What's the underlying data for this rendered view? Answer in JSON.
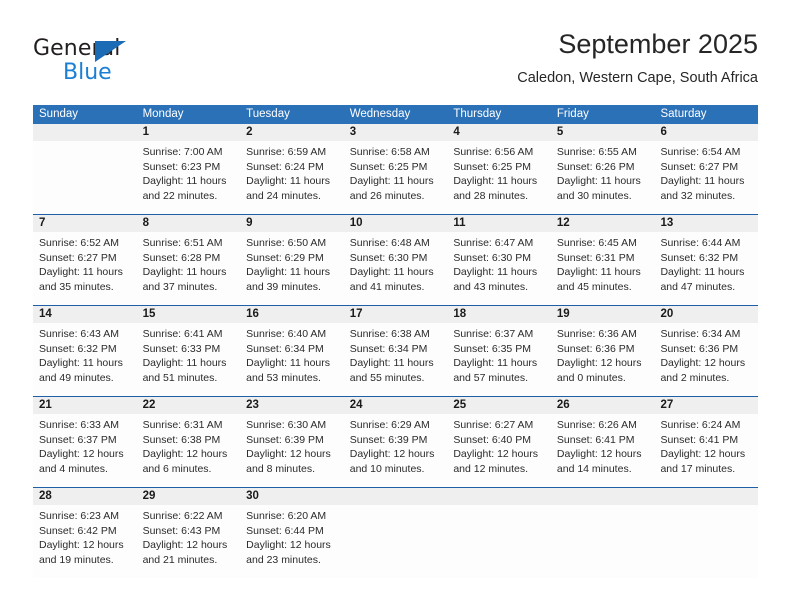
{
  "logo": {
    "word1": "General",
    "word2": "Blue",
    "triangle_color": "#1c6cb5",
    "blue_text_color": "#1b7fd4"
  },
  "header": {
    "title": "September 2025",
    "subtitle": "Caledon, Western Cape, South Africa"
  },
  "colors": {
    "header_row_bg": "#2b71b8",
    "week_separator": "#1f5fa8",
    "date_band_bg": "#efefef",
    "cell_bg": "#fdfdfd",
    "text": "#2b2b2b"
  },
  "weekday_headers": [
    "Sunday",
    "Monday",
    "Tuesday",
    "Wednesday",
    "Thursday",
    "Friday",
    "Saturday"
  ],
  "weeks": [
    [
      {
        "day": "",
        "sunrise": "",
        "sunset": "",
        "daylight_line1": "",
        "daylight_line2": ""
      },
      {
        "day": "1",
        "sunrise": "Sunrise: 7:00 AM",
        "sunset": "Sunset: 6:23 PM",
        "daylight_line1": "Daylight: 11 hours",
        "daylight_line2": "and 22 minutes."
      },
      {
        "day": "2",
        "sunrise": "Sunrise: 6:59 AM",
        "sunset": "Sunset: 6:24 PM",
        "daylight_line1": "Daylight: 11 hours",
        "daylight_line2": "and 24 minutes."
      },
      {
        "day": "3",
        "sunrise": "Sunrise: 6:58 AM",
        "sunset": "Sunset: 6:25 PM",
        "daylight_line1": "Daylight: 11 hours",
        "daylight_line2": "and 26 minutes."
      },
      {
        "day": "4",
        "sunrise": "Sunrise: 6:56 AM",
        "sunset": "Sunset: 6:25 PM",
        "daylight_line1": "Daylight: 11 hours",
        "daylight_line2": "and 28 minutes."
      },
      {
        "day": "5",
        "sunrise": "Sunrise: 6:55 AM",
        "sunset": "Sunset: 6:26 PM",
        "daylight_line1": "Daylight: 11 hours",
        "daylight_line2": "and 30 minutes."
      },
      {
        "day": "6",
        "sunrise": "Sunrise: 6:54 AM",
        "sunset": "Sunset: 6:27 PM",
        "daylight_line1": "Daylight: 11 hours",
        "daylight_line2": "and 32 minutes."
      }
    ],
    [
      {
        "day": "7",
        "sunrise": "Sunrise: 6:52 AM",
        "sunset": "Sunset: 6:27 PM",
        "daylight_line1": "Daylight: 11 hours",
        "daylight_line2": "and 35 minutes."
      },
      {
        "day": "8",
        "sunrise": "Sunrise: 6:51 AM",
        "sunset": "Sunset: 6:28 PM",
        "daylight_line1": "Daylight: 11 hours",
        "daylight_line2": "and 37 minutes."
      },
      {
        "day": "9",
        "sunrise": "Sunrise: 6:50 AM",
        "sunset": "Sunset: 6:29 PM",
        "daylight_line1": "Daylight: 11 hours",
        "daylight_line2": "and 39 minutes."
      },
      {
        "day": "10",
        "sunrise": "Sunrise: 6:48 AM",
        "sunset": "Sunset: 6:30 PM",
        "daylight_line1": "Daylight: 11 hours",
        "daylight_line2": "and 41 minutes."
      },
      {
        "day": "11",
        "sunrise": "Sunrise: 6:47 AM",
        "sunset": "Sunset: 6:30 PM",
        "daylight_line1": "Daylight: 11 hours",
        "daylight_line2": "and 43 minutes."
      },
      {
        "day": "12",
        "sunrise": "Sunrise: 6:45 AM",
        "sunset": "Sunset: 6:31 PM",
        "daylight_line1": "Daylight: 11 hours",
        "daylight_line2": "and 45 minutes."
      },
      {
        "day": "13",
        "sunrise": "Sunrise: 6:44 AM",
        "sunset": "Sunset: 6:32 PM",
        "daylight_line1": "Daylight: 11 hours",
        "daylight_line2": "and 47 minutes."
      }
    ],
    [
      {
        "day": "14",
        "sunrise": "Sunrise: 6:43 AM",
        "sunset": "Sunset: 6:32 PM",
        "daylight_line1": "Daylight: 11 hours",
        "daylight_line2": "and 49 minutes."
      },
      {
        "day": "15",
        "sunrise": "Sunrise: 6:41 AM",
        "sunset": "Sunset: 6:33 PM",
        "daylight_line1": "Daylight: 11 hours",
        "daylight_line2": "and 51 minutes."
      },
      {
        "day": "16",
        "sunrise": "Sunrise: 6:40 AM",
        "sunset": "Sunset: 6:34 PM",
        "daylight_line1": "Daylight: 11 hours",
        "daylight_line2": "and 53 minutes."
      },
      {
        "day": "17",
        "sunrise": "Sunrise: 6:38 AM",
        "sunset": "Sunset: 6:34 PM",
        "daylight_line1": "Daylight: 11 hours",
        "daylight_line2": "and 55 minutes."
      },
      {
        "day": "18",
        "sunrise": "Sunrise: 6:37 AM",
        "sunset": "Sunset: 6:35 PM",
        "daylight_line1": "Daylight: 11 hours",
        "daylight_line2": "and 57 minutes."
      },
      {
        "day": "19",
        "sunrise": "Sunrise: 6:36 AM",
        "sunset": "Sunset: 6:36 PM",
        "daylight_line1": "Daylight: 12 hours",
        "daylight_line2": "and 0 minutes."
      },
      {
        "day": "20",
        "sunrise": "Sunrise: 6:34 AM",
        "sunset": "Sunset: 6:36 PM",
        "daylight_line1": "Daylight: 12 hours",
        "daylight_line2": "and 2 minutes."
      }
    ],
    [
      {
        "day": "21",
        "sunrise": "Sunrise: 6:33 AM",
        "sunset": "Sunset: 6:37 PM",
        "daylight_line1": "Daylight: 12 hours",
        "daylight_line2": "and 4 minutes."
      },
      {
        "day": "22",
        "sunrise": "Sunrise: 6:31 AM",
        "sunset": "Sunset: 6:38 PM",
        "daylight_line1": "Daylight: 12 hours",
        "daylight_line2": "and 6 minutes."
      },
      {
        "day": "23",
        "sunrise": "Sunrise: 6:30 AM",
        "sunset": "Sunset: 6:39 PM",
        "daylight_line1": "Daylight: 12 hours",
        "daylight_line2": "and 8 minutes."
      },
      {
        "day": "24",
        "sunrise": "Sunrise: 6:29 AM",
        "sunset": "Sunset: 6:39 PM",
        "daylight_line1": "Daylight: 12 hours",
        "daylight_line2": "and 10 minutes."
      },
      {
        "day": "25",
        "sunrise": "Sunrise: 6:27 AM",
        "sunset": "Sunset: 6:40 PM",
        "daylight_line1": "Daylight: 12 hours",
        "daylight_line2": "and 12 minutes."
      },
      {
        "day": "26",
        "sunrise": "Sunrise: 6:26 AM",
        "sunset": "Sunset: 6:41 PM",
        "daylight_line1": "Daylight: 12 hours",
        "daylight_line2": "and 14 minutes."
      },
      {
        "day": "27",
        "sunrise": "Sunrise: 6:24 AM",
        "sunset": "Sunset: 6:41 PM",
        "daylight_line1": "Daylight: 12 hours",
        "daylight_line2": "and 17 minutes."
      }
    ],
    [
      {
        "day": "28",
        "sunrise": "Sunrise: 6:23 AM",
        "sunset": "Sunset: 6:42 PM",
        "daylight_line1": "Daylight: 12 hours",
        "daylight_line2": "and 19 minutes."
      },
      {
        "day": "29",
        "sunrise": "Sunrise: 6:22 AM",
        "sunset": "Sunset: 6:43 PM",
        "daylight_line1": "Daylight: 12 hours",
        "daylight_line2": "and 21 minutes."
      },
      {
        "day": "30",
        "sunrise": "Sunrise: 6:20 AM",
        "sunset": "Sunset: 6:44 PM",
        "daylight_line1": "Daylight: 12 hours",
        "daylight_line2": "and 23 minutes."
      },
      {
        "day": "",
        "sunrise": "",
        "sunset": "",
        "daylight_line1": "",
        "daylight_line2": ""
      },
      {
        "day": "",
        "sunrise": "",
        "sunset": "",
        "daylight_line1": "",
        "daylight_line2": ""
      },
      {
        "day": "",
        "sunrise": "",
        "sunset": "",
        "daylight_line1": "",
        "daylight_line2": ""
      },
      {
        "day": "",
        "sunrise": "",
        "sunset": "",
        "daylight_line1": "",
        "daylight_line2": ""
      }
    ]
  ]
}
